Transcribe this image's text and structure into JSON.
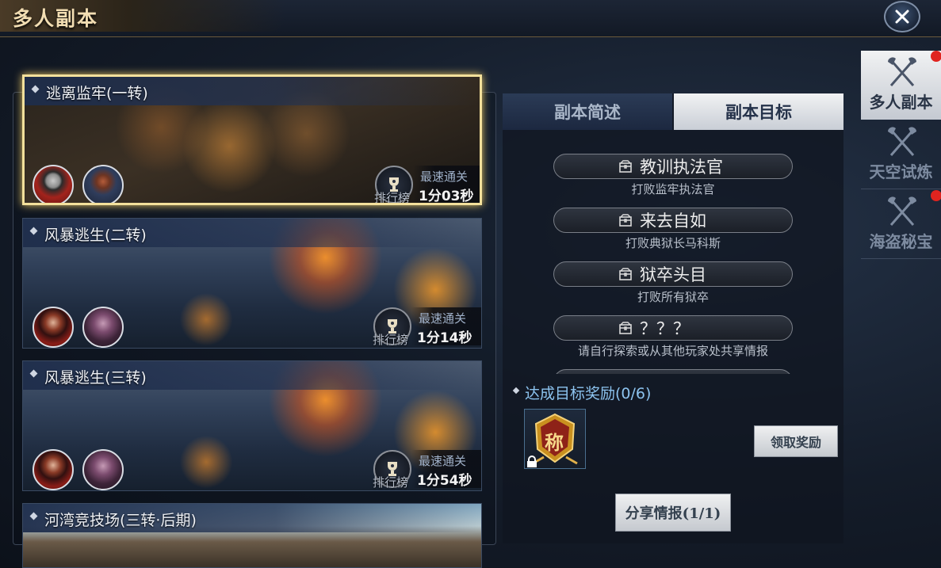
{
  "header": {
    "title": "多人副本"
  },
  "dungeons": [
    {
      "name": "逃离监牢(一转)",
      "rank_label": "排行榜",
      "fastest_label": "最速通关",
      "fastest_time": "1分03秒"
    },
    {
      "name": "风暴逃生(二转)",
      "rank_label": "排行榜",
      "fastest_label": "最速通关",
      "fastest_time": "1分14秒"
    },
    {
      "name": "风暴逃生(三转)",
      "rank_label": "排行榜",
      "fastest_label": "最速通关",
      "fastest_time": "1分54秒"
    },
    {
      "name": "河湾竞技场(三转·后期)"
    }
  ],
  "detail": {
    "tabs": [
      {
        "label": "副本简述"
      },
      {
        "label": "副本目标"
      }
    ],
    "active_tab": "副本目标",
    "goals": [
      {
        "title": "教训执法官",
        "desc": "打败监牢执法官"
      },
      {
        "title": "来去自如",
        "desc": "打败典狱长马科斯"
      },
      {
        "title": "狱卒头目",
        "desc": "打败所有狱卒"
      },
      {
        "title": "？？？",
        "desc": "请自行探索或从其他玩家处共享情报"
      },
      {
        "title": "？？？"
      }
    ],
    "reward_title": "达成目标奖励(0/6)",
    "reward_item_glyph": "称",
    "claim_label": "领取奖励",
    "share_label": "分享情报(1/1)"
  },
  "side_tabs": [
    {
      "label": "多人副本",
      "active": true,
      "badge": true
    },
    {
      "label": "天空试炼",
      "active": false,
      "badge": false
    },
    {
      "label": "海盗秘宝",
      "active": false,
      "badge": true
    }
  ],
  "colors": {
    "accent_gold": "#f3e09b",
    "reward_blue": "#8cc3ef",
    "badge_red": "#e0241f"
  },
  "icons": [
    "close-icon",
    "trophy-icon",
    "crossed-axes-icon",
    "lock-icon",
    "treasure-chest-icon"
  ]
}
